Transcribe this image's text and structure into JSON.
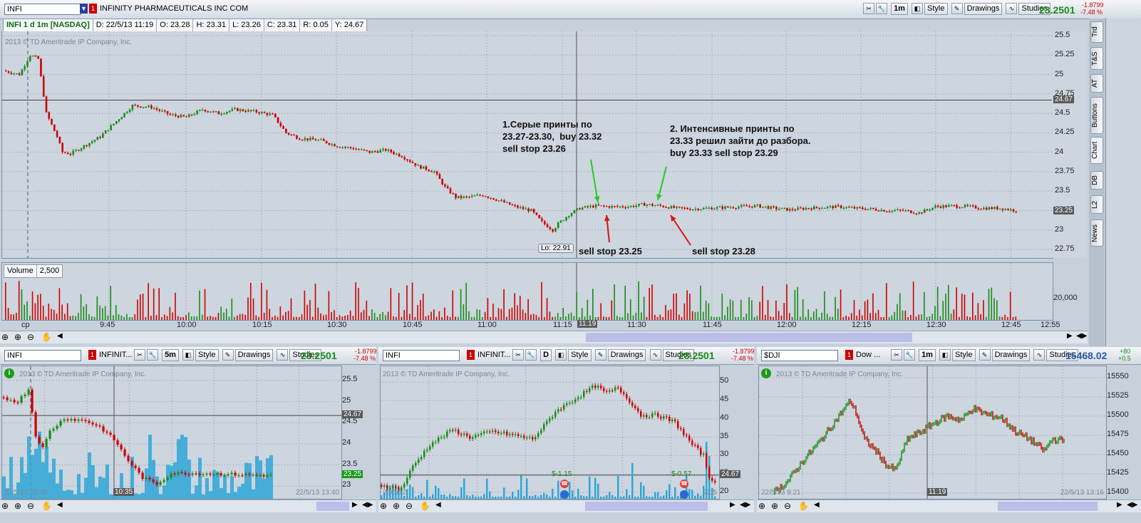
{
  "main": {
    "symbol": "INFI",
    "company": "INFINITY PHARMACEUTICALS INC COM",
    "timeframe": "1m",
    "style_label": "Style",
    "drawings_label": "Drawings",
    "studies_label": "Studies",
    "last_price": "23.2501",
    "change": "-1.8799",
    "change_pct": "-7.48 %",
    "info": {
      "title": "INFI 1 d 1m [NASDAQ]",
      "date": "D: 22/5/13 11:19",
      "open": "O: 23.28",
      "high": "H: 23.31",
      "low": "L: 23.26",
      "close": "C: 23.31",
      "range": "R: 0.05",
      "y": "Y: 24.67"
    },
    "copyright": "2013 © TD Ameritrade IP Company, Inc.",
    "low_label": "Lo: 22.91",
    "price_axis": [
      "25.5",
      "25.25",
      "25",
      "24.75",
      "24.5",
      "24.25",
      "24",
      "23.75",
      "23.5",
      "23.25",
      "23",
      "22.75"
    ],
    "prev_close_tag": "24.67",
    "last_tag": "23.25",
    "volume_label": "Volume",
    "volume_value": "2,500",
    "volume_axis": "20,000",
    "time_axis": [
      "cp",
      "9:45",
      "10:00",
      "10:15",
      "10:30",
      "10:45",
      "11:00",
      "11:15",
      "11:30",
      "11:45",
      "12:00",
      "12:15",
      "12:30",
      "12:45",
      "12:55"
    ],
    "cursor_time": "11:19",
    "annotations": {
      "note1": "1.Серые принты по\n23.27-23.30,  buy 23.32\nsell stop 23.26",
      "note2": "2. Интенсивные принты по\n23.33 решил зайти до разбора.\nbuy 23.33 sell stop 23.29",
      "stop1": "sell stop 23.25",
      "stop2": "sell stop 23.28"
    },
    "colors": {
      "up": "#1a8a1a",
      "down": "#cc0000",
      "bg": "#cdd5de",
      "green_arrow": "#22cc22",
      "red_arrow": "#dd1111"
    }
  },
  "side_tabs": [
    "Trd",
    "T&S",
    "AT",
    "Buttons",
    "Chart",
    "DB",
    "L2",
    "News"
  ],
  "panels": [
    {
      "symbol": "INFI",
      "company": "INFINIT...",
      "timeframe": "5m",
      "style_label": "Style",
      "drawings_label": "Drawings",
      "studies_label": "Studies",
      "last_price": "23.2501",
      "change": "-1.8799",
      "change_pct": "-7.48 %",
      "copyright": "2013 © TD Ameritrade IP Company, Inc.",
      "price_axis": [
        "25.5",
        "25",
        "24.5",
        "24",
        "23.5",
        "23"
      ],
      "tag1": "24.67",
      "tag2": "23.25",
      "start_label": "21/5/13 15:40",
      "cursor_label": "10:35",
      "end_label": "22/5/13 13:40"
    },
    {
      "symbol": "INFI",
      "company": "INFINIT...",
      "timeframe": "D",
      "style_label": "Style",
      "drawings_label": "Drawings",
      "studies_label": "Studies",
      "last_price": "23.2501",
      "change": "-1.8799",
      "change_pct": "-7.48 %",
      "copyright": "2013 © TD Ameritrade IP Company, Inc.",
      "price_axis": [
        "50",
        "45",
        "40",
        "35",
        "30",
        "25",
        "20"
      ],
      "tag1": "24.67",
      "dividend1": "$-1.15",
      "dividend2": "$-0.57",
      "start_label": "28/5/12",
      "end_label": "22/5"
    },
    {
      "symbol": "$DJI",
      "company": "Dow ...",
      "timeframe": "1m",
      "style_label": "Style",
      "drawings_label": "Drawings",
      "studies_label": "Studies",
      "last_price": "15468.02",
      "change": "+80",
      "change_pct": "+0.5",
      "copyright": "2013 © TD Ameritrade IP Company, Inc.",
      "price_axis": [
        "15550",
        "15525",
        "15500",
        "15475",
        "15450",
        "15425",
        "15400"
      ],
      "start_label": "22/5/13 9:21",
      "cursor_label": "11:19",
      "end_label": "22/5/13 13:16"
    }
  ]
}
